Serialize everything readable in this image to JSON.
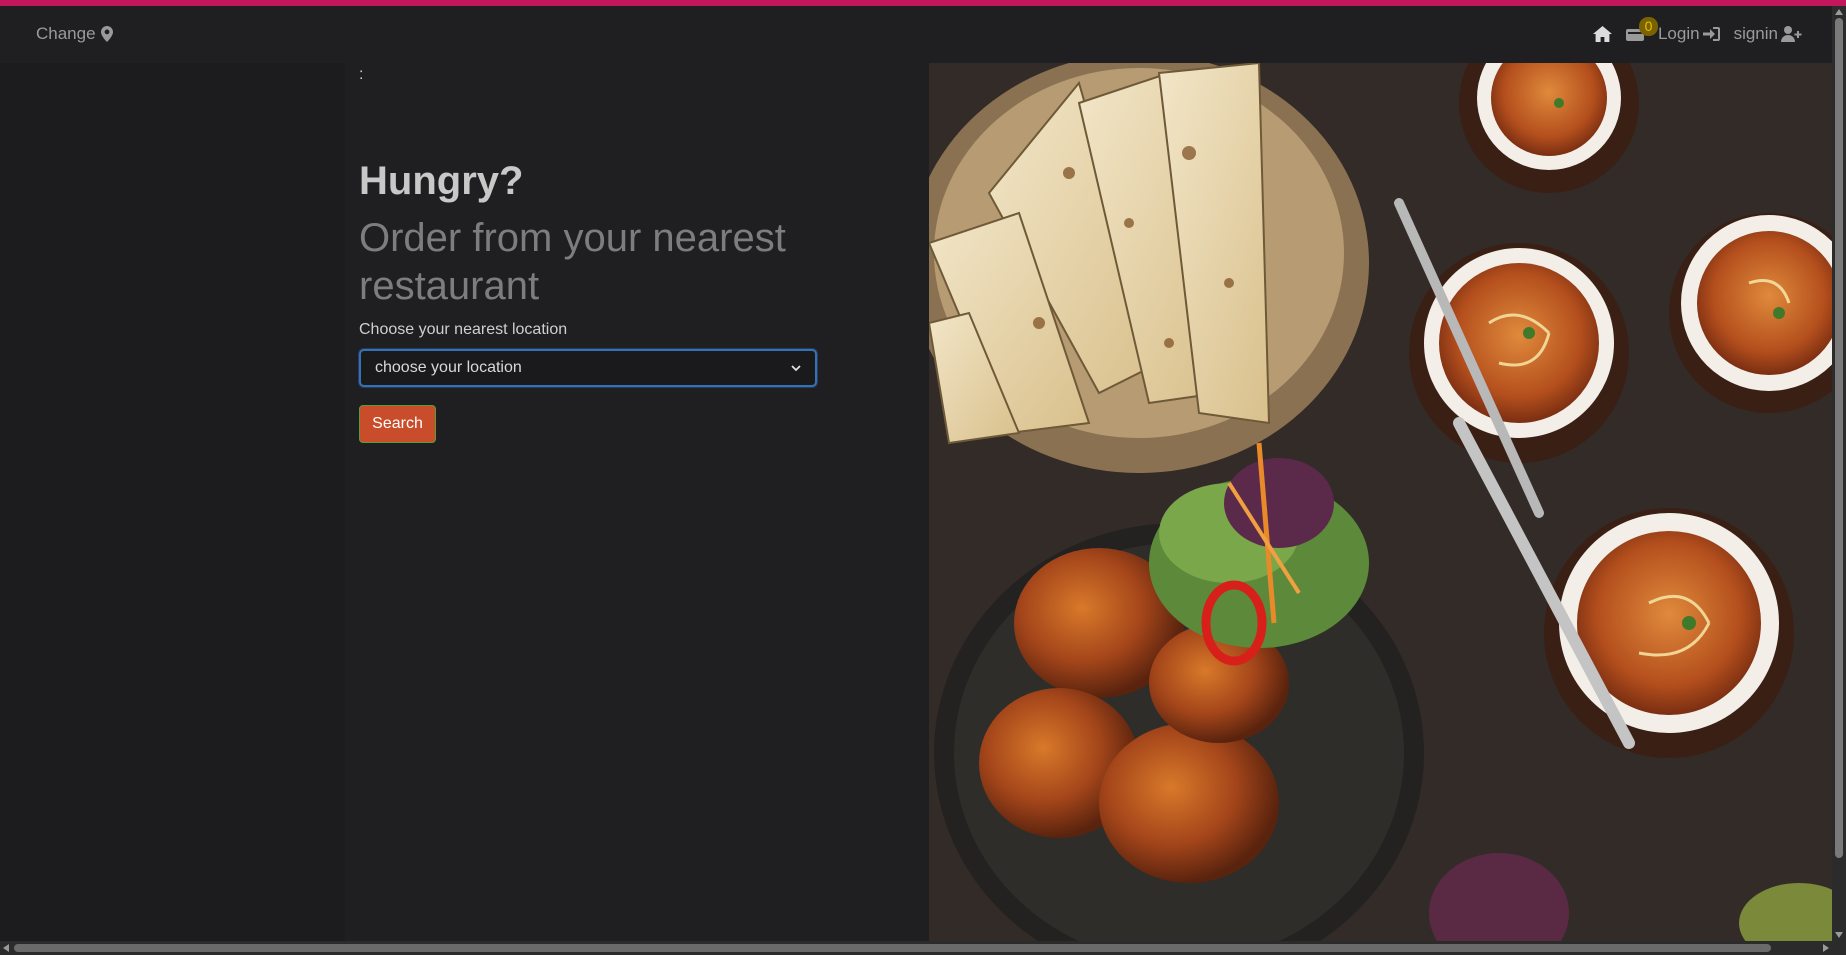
{
  "nav": {
    "change_label": "Change",
    "cart_count": "0",
    "login_label": "Login",
    "signin_label": "signin"
  },
  "main": {
    "colon": ":",
    "heading": "Hungry?",
    "subheading": "Order from your nearest restaurant",
    "location_label": "Choose your nearest location",
    "location_select_value": "choose your location",
    "search_button": "Search"
  },
  "colors": {
    "top_stripe": "#c2185b",
    "search_button_bg": "#c94d2a",
    "select_border": "#3a6fb0",
    "cart_badge": "#7a6200"
  },
  "icons": [
    "map-marker-icon",
    "home-icon",
    "cart-icon",
    "login-icon",
    "user-plus-icon"
  ]
}
